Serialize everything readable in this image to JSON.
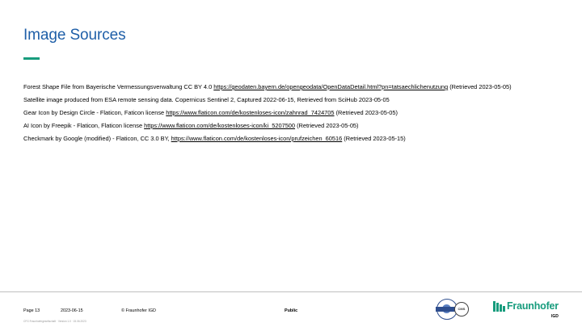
{
  "page": {
    "title": "Image Sources"
  },
  "sources": [
    {
      "text": "Forest Shape File from Bayerische Vermessungsverwaltung CC BY 4.0 ",
      "link": "https://geodaten.bayern.de/opengeodata/OpenDataDetail.html?pn=tatsaechlichenutzung",
      "suffix": "  (Retrieved 2023-05-05)"
    },
    {
      "text": "Satellite image produced from ESA remote sensing data. Copernicus Sentinel 2, Captured 2022-06-15, Retrieved from SciHub 2023-05-05",
      "link": "",
      "suffix": ""
    },
    {
      "text": "Gear Icon by Design Circle - Flaticon, Faticon license ",
      "link": "https://www.flaticon.com/de/kostenloses-icon/zahnrad_7424705",
      "suffix": " (Retrieved 2023-05-05)"
    },
    {
      "text": "AI Icon by Freepik - Flaticon, Flaticon license ",
      "link": "https://www.flaticon.com/de/kostenloses-icon/ki_5207500",
      "suffix": " (Retrieved 2023-05-05)"
    },
    {
      "text": "Checkmark by Google (modified) - Flaticon, CC 3.0 BY, ",
      "link": "https://www.flaticon.com/de/kostenloses-icon/prufzeichen_60516",
      "suffix": " (Retrieved 2023-05-15)"
    }
  ],
  "footer": {
    "page_label": "Page 13",
    "date": "2023-06-15",
    "copyright": "© Fraunhofer IGD",
    "classification": "Public",
    "tiny_note": "CFG Fraunhofergesellschaft · Version 1.0 · 15.06.2023"
  },
  "logo": {
    "name": "Fraunhofer",
    "sub": "IGD",
    "brand_color": "#179c7d"
  },
  "colors": {
    "title": "#1f5fa8",
    "accent": "#179c7d",
    "rule": "#bfbfbf"
  }
}
